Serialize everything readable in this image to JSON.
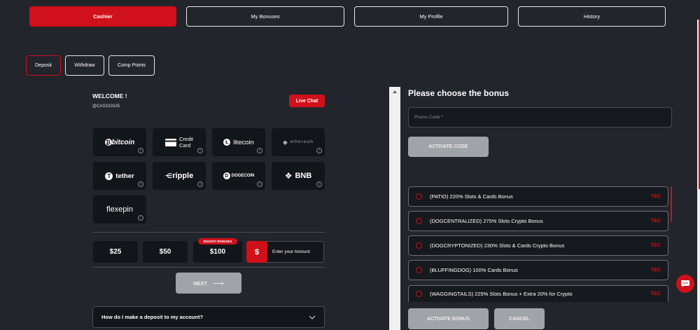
{
  "top_tabs": [
    "Cashier",
    "My Bonuses",
    "My Profile",
    "History"
  ],
  "sub_tabs": [
    "Deposit",
    "Withdraw",
    "Comp Points"
  ],
  "welcome": {
    "title": "WELCOME !",
    "user_id": "@CASS23325"
  },
  "live_chat": "Live Chat",
  "payment_methods": {
    "bitcoin": "bitcoin",
    "credit_card_line1": "Credit",
    "credit_card_line2": "Card",
    "litecoin": "litecoin",
    "ethereum": "ethereum",
    "tether": "tether",
    "ripple": "ripple",
    "dogecoin": "DOGECOIN",
    "bnb": "BNB",
    "flexepin": "flexepin",
    "info": "i"
  },
  "amounts": {
    "a25": "$25",
    "a50": "$50",
    "a100": "$100",
    "biggest_bonuses": "BIGGEST BONUSES",
    "currency_symbol": "$",
    "enter_amount": "Enter your Amount"
  },
  "next_label": "NEXT",
  "faq_question": "How do I make a deposit to my account?",
  "bonus_panel": {
    "title": "Please choose the bonus",
    "promo_placeholder": "Promo Code *",
    "activate_code": "ACTIVATE CODE",
    "tc_label": "T&C",
    "bonuses": [
      "(PATIO) 220% Slots & Cards Bonus",
      "(DOGCENTRALIZED) 275% Slots Crypto Bonus",
      "(DOGCRYPTONIZED) 230% Slots & Cards Crypto Bonus",
      "(BLUFFINGDOG) 100% Cards Bonus",
      "(WAGGINGTAILS) 225% Slots Bonus + Extra 20% for Crypto"
    ],
    "activate_bonus": "ACTIVATE BONUS",
    "cancel": "CANCEL"
  },
  "colors": {
    "accent": "#d0101a",
    "background": "#22252b",
    "tile": "#121519"
  }
}
